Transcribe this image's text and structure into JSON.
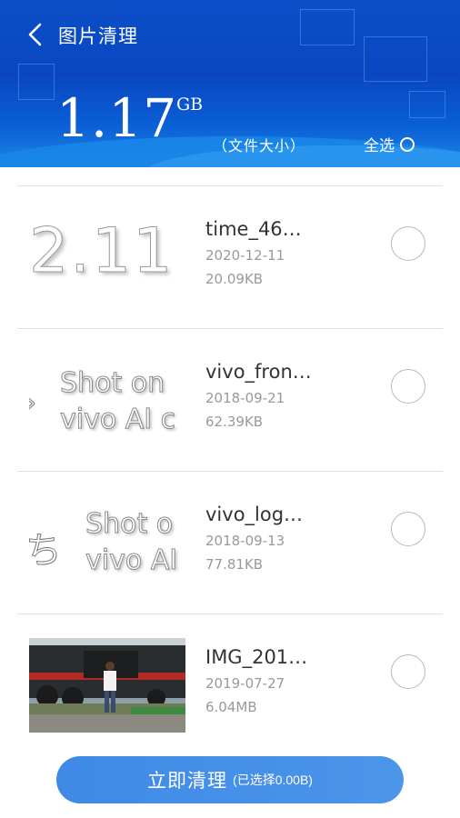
{
  "header": {
    "title": "图片清理",
    "size_value": "1.17",
    "size_unit": "GB",
    "size_caption": "（文件大小）",
    "select_all_label": "全选"
  },
  "thumbnails": {
    "t1_text": "2.11",
    "t2_text": "Shot on\nvivo AI c",
    "t3_text": "Shot o\nvivo AI"
  },
  "items": [
    {
      "name": "time_46…",
      "date": "2020-12-11",
      "size": "20.09KB"
    },
    {
      "name": "vivo_fron…",
      "date": "2018-09-21",
      "size": "62.39KB"
    },
    {
      "name": "vivo_log…",
      "date": "2018-09-13",
      "size": "77.81KB"
    },
    {
      "name": "IMG_201…",
      "date": "2019-07-27",
      "size": "6.04MB"
    }
  ],
  "footer": {
    "clean_label": "立即清理",
    "selected_info": "(已选择0.00B)"
  },
  "colors": {
    "header_bg": "#0b4fc9",
    "button_bg": "#4490e8",
    "separator": "#e3e3e3"
  }
}
